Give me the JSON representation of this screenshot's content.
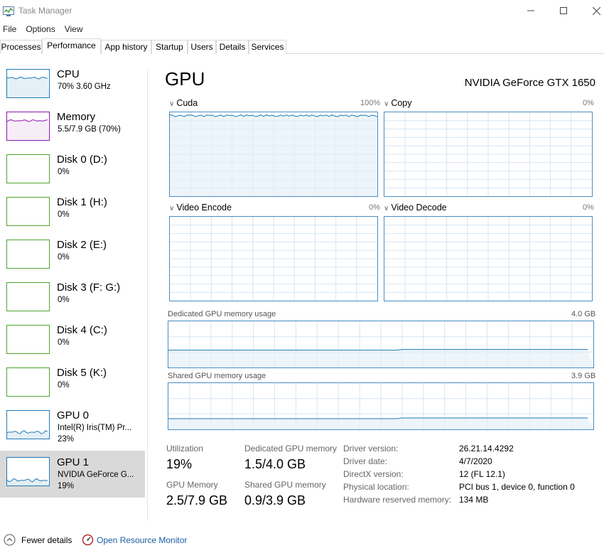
{
  "window": {
    "title": "Task Manager"
  },
  "menu": [
    "File",
    "Options",
    "View"
  ],
  "tabs": [
    "Processes",
    "Performance",
    "App history",
    "Startup",
    "Users",
    "Details",
    "Services"
  ],
  "active_tab": "Performance",
  "sidebar": [
    {
      "name": "CPU",
      "line1": "70%  3.60 GHz",
      "line2": "",
      "color": "#1f7ab8",
      "level": 0.7
    },
    {
      "name": "Memory",
      "line1": "5.5/7.9 GB (70%)",
      "line2": "",
      "color": "#8b18a8",
      "level": 0.7
    },
    {
      "name": "Disk 0 (D:)",
      "line1": "0%",
      "line2": "",
      "color": "#4fa52f",
      "level": 0
    },
    {
      "name": "Disk 1 (H:)",
      "line1": "0%",
      "line2": "",
      "color": "#4fa52f",
      "level": 0
    },
    {
      "name": "Disk 2 (E:)",
      "line1": "0%",
      "line2": "",
      "color": "#4fa52f",
      "level": 0
    },
    {
      "name": "Disk 3 (F: G:)",
      "line1": "0%",
      "line2": "",
      "color": "#4fa52f",
      "level": 0
    },
    {
      "name": "Disk 4 (C:)",
      "line1": "0%",
      "line2": "",
      "color": "#4fa52f",
      "level": 0
    },
    {
      "name": "Disk 5 (K:)",
      "line1": "0%",
      "line2": "",
      "color": "#4fa52f",
      "level": 0
    },
    {
      "name": "GPU 0",
      "line1": "Intel(R) Iris(TM) Pr...",
      "line2": "23%",
      "color": "#1f7ab8",
      "level": 0.23
    },
    {
      "name": "GPU 1",
      "line1": "NVIDIA GeForce G...",
      "line2": "19%",
      "color": "#1f7ab8",
      "level": 0.19
    }
  ],
  "main": {
    "title": "GPU",
    "device": "NVIDIA GeForce GTX 1650",
    "engines": [
      {
        "name": "Cuda",
        "max": "100%",
        "level": 0.97
      },
      {
        "name": "Copy",
        "max": "0%",
        "level": 0
      },
      {
        "name": "Video Encode",
        "max": "0%",
        "level": 0
      },
      {
        "name": "Video Decode",
        "max": "0%",
        "level": 0
      }
    ],
    "dedicated": {
      "label": "Dedicated GPU memory usage",
      "max": "4.0 GB",
      "level": 0.375
    },
    "shared": {
      "label": "Shared GPU memory usage",
      "max": "3.9 GB",
      "level": 0.23
    },
    "stats": {
      "utilization_label": "Utilization",
      "utilization": "19%",
      "dedicated_label": "Dedicated GPU memory",
      "dedicated": "1.5/4.0 GB",
      "gpu_memory_label": "GPU Memory",
      "gpu_memory": "2.5/7.9 GB",
      "shared_label": "Shared GPU memory",
      "shared": "0.9/3.9 GB"
    },
    "info": [
      {
        "label": "Driver version:",
        "value": "26.21.14.4292"
      },
      {
        "label": "Driver date:",
        "value": "4/7/2020"
      },
      {
        "label": "DirectX version:",
        "value": "12 (FL 12.1)"
      },
      {
        "label": "Physical location:",
        "value": "PCI bus 1, device 0, function 0"
      },
      {
        "label": "Hardware reserved memory:",
        "value": "134 MB"
      }
    ]
  },
  "footer": {
    "fewer_details": "Fewer details",
    "resource_monitor": "Open Resource Monitor"
  },
  "colors": {
    "graph_border": "#4a8cc2",
    "grid": "#d6e6f3",
    "fill": "#e6f0f8",
    "line": "#1f7ab8",
    "link": "#1a5ea6",
    "selected": "#d9d9d9"
  }
}
